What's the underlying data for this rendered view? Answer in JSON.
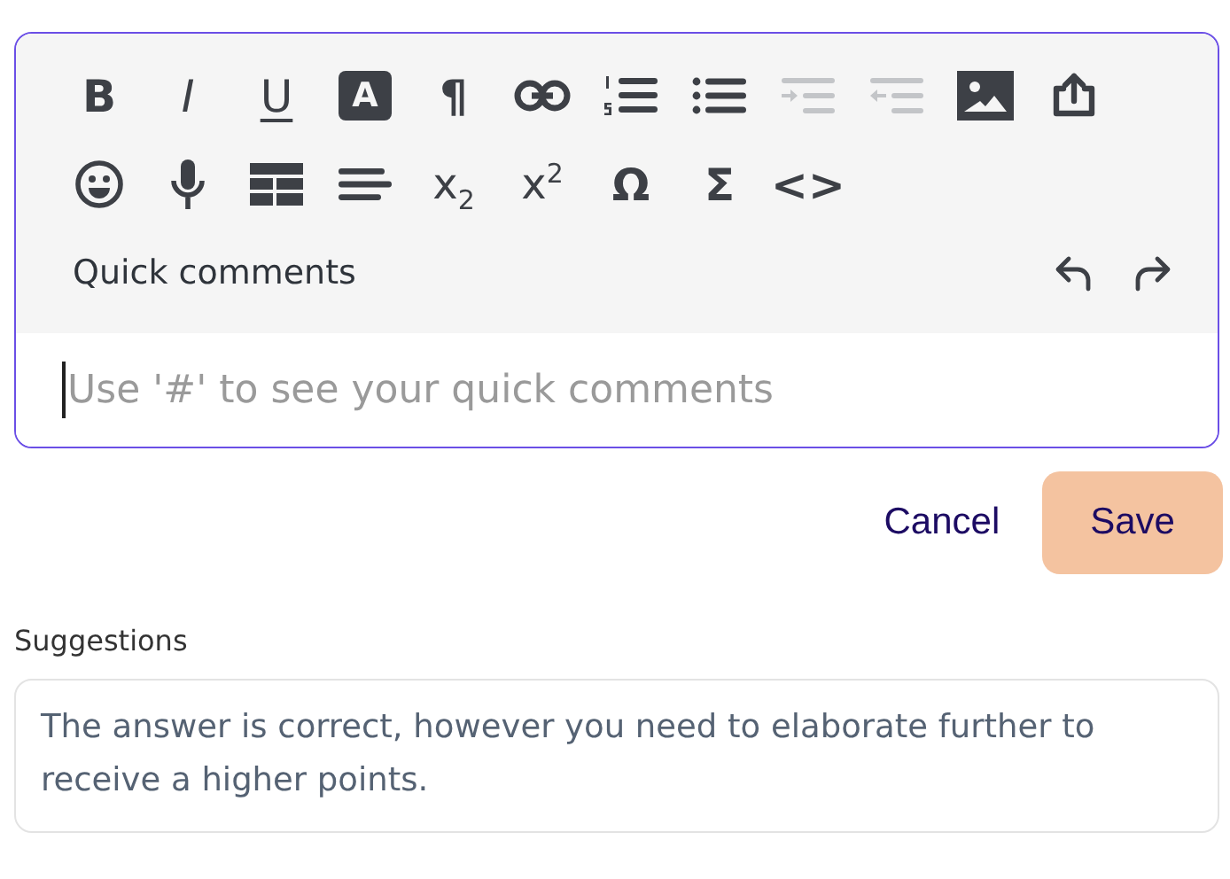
{
  "toolbar": {
    "rows": [
      [
        {
          "kind": "bold",
          "label": "B"
        },
        {
          "kind": "italic",
          "label": "I"
        },
        {
          "kind": "underline",
          "label": "U"
        },
        {
          "kind": "inverted",
          "label": "A"
        },
        {
          "kind": "glyph",
          "label": "¶"
        },
        {
          "kind": "link",
          "disabled": false
        },
        {
          "kind": "numbered-list",
          "disabled": false
        },
        {
          "kind": "bullet-list",
          "disabled": false
        },
        {
          "kind": "indent",
          "disabled": true
        },
        {
          "kind": "outdent",
          "disabled": true
        },
        {
          "kind": "image",
          "disabled": false
        },
        {
          "kind": "share",
          "disabled": false
        }
      ],
      [
        {
          "kind": "emoji",
          "disabled": false
        },
        {
          "kind": "microphone",
          "disabled": false
        },
        {
          "kind": "table",
          "disabled": false
        },
        {
          "kind": "align",
          "disabled": false
        },
        {
          "kind": "script",
          "label": "x$_{2}$"
        },
        {
          "kind": "script",
          "label": "x$^{2}$"
        },
        {
          "kind": "glyph",
          "label": "Ω"
        },
        {
          "kind": "glyph",
          "label": "Σ"
        },
        {
          "kind": "glyph",
          "label": "<>"
        }
      ]
    ],
    "quick_comments": "Quick comments"
  },
  "editor": {
    "placeholder": "Use '#' to see your quick comments"
  },
  "buttons": [
    {
      "label": "Cancel",
      "kind": "link"
    },
    {
      "label": "Save",
      "kind": "primary"
    }
  ],
  "suggestions": {
    "label": "Suggestions",
    "text": "The answer is correct, however you need to elaborate further to receive a higher points."
  }
}
